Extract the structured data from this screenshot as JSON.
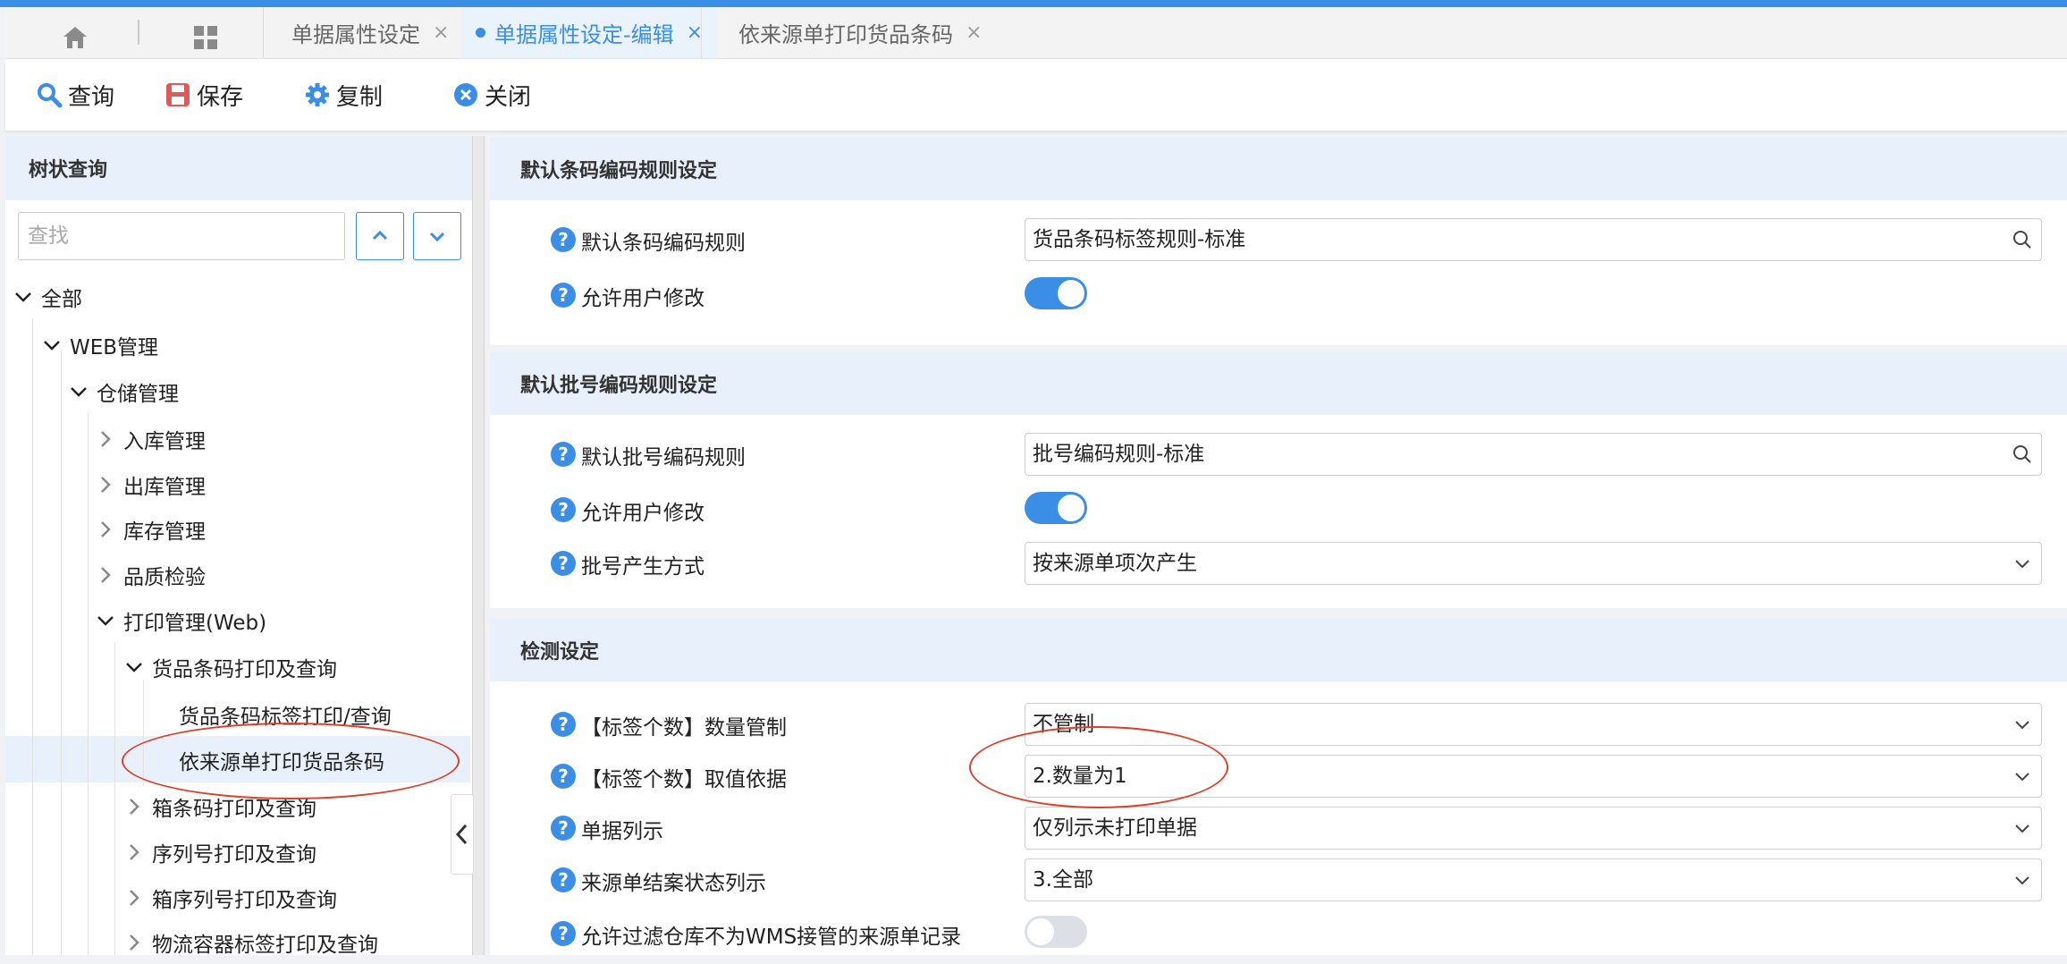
{
  "tabs": [
    {
      "label": "单据属性设定"
    },
    {
      "label": "单据属性设定-编辑"
    },
    {
      "label": "依来源单打印货品条码"
    }
  ],
  "tab_close": "×",
  "toolbar": {
    "query": "查询",
    "save": "保存",
    "copy": "复制",
    "close": "关闭"
  },
  "tree": {
    "title": "树状查询",
    "search_placeholder": "查找",
    "nodes": [
      {
        "label": "全部"
      },
      {
        "label": "WEB管理"
      },
      {
        "label": "仓储管理"
      },
      {
        "label": "入库管理"
      },
      {
        "label": "出库管理"
      },
      {
        "label": "库存管理"
      },
      {
        "label": "品质检验"
      },
      {
        "label": "打印管理(Web)"
      },
      {
        "label": "货品条码打印及查询"
      },
      {
        "label": "货品条码标签打印/查询"
      },
      {
        "label": "依来源单打印货品条码"
      },
      {
        "label": "箱条码打印及查询"
      },
      {
        "label": "序列号打印及查询"
      },
      {
        "label": "箱序列号打印及查询"
      },
      {
        "label": "物流容器标签打印及查询"
      }
    ]
  },
  "sections": {
    "barcode": {
      "title": "默认条码编码规则设定",
      "rows": [
        {
          "label": "默认条码编码规则",
          "value": "货品条码标签规则-标准"
        },
        {
          "label": "允许用户修改",
          "state": true
        }
      ]
    },
    "batch": {
      "title": "默认批号编码规则设定",
      "rows": [
        {
          "label": "默认批号编码规则",
          "value": "批号编码规则-标准"
        },
        {
          "label": "允许用户修改",
          "state": true
        },
        {
          "label": "批号产生方式",
          "value": "按来源单项次产生"
        }
      ]
    },
    "check": {
      "title": "检测设定",
      "rows": [
        {
          "label": "【标签个数】数量管制",
          "value": "不管制"
        },
        {
          "label": "【标签个数】取值依据",
          "value": "2.数量为1"
        },
        {
          "label": "单据列示",
          "value": "仅列示未打印单据"
        },
        {
          "label": "来源单结案状态列示",
          "value": "3.全部"
        },
        {
          "label": "允许过滤仓库不为WMS接管的来源单记录",
          "state": false
        }
      ]
    }
  },
  "help_glyph": "?",
  "colors": {
    "accent": "#3a8ee6",
    "header_bg": "#e8f1fb",
    "annotation": "#d9402a"
  }
}
